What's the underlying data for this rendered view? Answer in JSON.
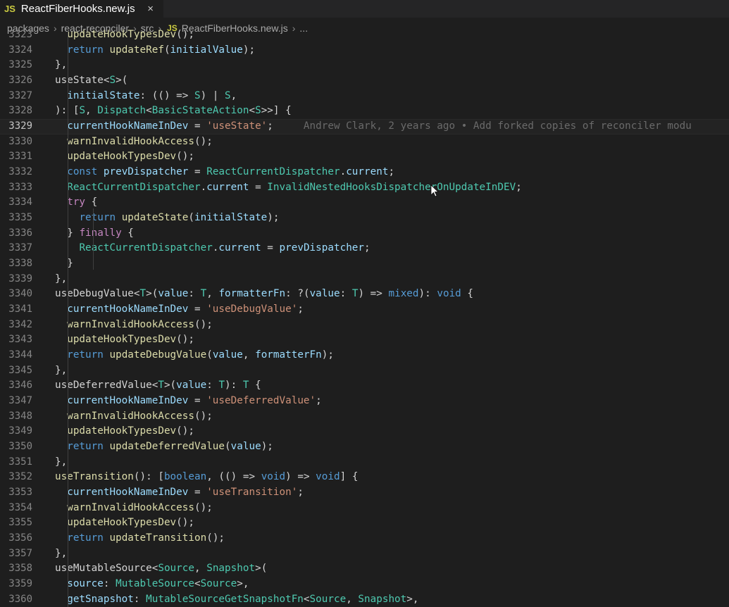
{
  "tab": {
    "icon": "JS",
    "title": "ReactFiberHooks.new.js",
    "close": "×"
  },
  "breadcrumb": [
    "packages",
    "react-reconciler",
    "src",
    "ReactFiberHooks.new.js",
    "..."
  ],
  "breadcrumb_file_icon": "JS",
  "editor": {
    "active_line": "3329",
    "blame": "Andrew Clark, 2 years ago • Add forked copies of reconciler modu",
    "lines": [
      {
        "n": "3323",
        "t": "      updateHookTypesDev();"
      },
      {
        "n": "3324",
        "t": "      return updateRef(initialValue);"
      },
      {
        "n": "3325",
        "t": "    },"
      },
      {
        "n": "3326",
        "t": "    useState<S>("
      },
      {
        "n": "3327",
        "t": "      initialState: (() => S) | S,"
      },
      {
        "n": "3328",
        "t": "    ): [S, Dispatch<BasicStateAction<S>>] {"
      },
      {
        "n": "3329",
        "t": "      currentHookNameInDev = 'useState';"
      },
      {
        "n": "3330",
        "t": "      warnInvalidHookAccess();"
      },
      {
        "n": "3331",
        "t": "      updateHookTypesDev();"
      },
      {
        "n": "3332",
        "t": "      const prevDispatcher = ReactCurrentDispatcher.current;"
      },
      {
        "n": "3333",
        "t": "      ReactCurrentDispatcher.current = InvalidNestedHooksDispatcherOnUpdateInDEV;"
      },
      {
        "n": "3334",
        "t": "      try {"
      },
      {
        "n": "3335",
        "t": "        return updateState(initialState);"
      },
      {
        "n": "3336",
        "t": "      } finally {"
      },
      {
        "n": "3337",
        "t": "        ReactCurrentDispatcher.current = prevDispatcher;"
      },
      {
        "n": "3338",
        "t": "      }"
      },
      {
        "n": "3339",
        "t": "    },"
      },
      {
        "n": "3340",
        "t": "    useDebugValue<T>(value: T, formatterFn: ?(value: T) => mixed): void {"
      },
      {
        "n": "3341",
        "t": "      currentHookNameInDev = 'useDebugValue';"
      },
      {
        "n": "3342",
        "t": "      warnInvalidHookAccess();"
      },
      {
        "n": "3343",
        "t": "      updateHookTypesDev();"
      },
      {
        "n": "3344",
        "t": "      return updateDebugValue(value, formatterFn);"
      },
      {
        "n": "3345",
        "t": "    },"
      },
      {
        "n": "3346",
        "t": "    useDeferredValue<T>(value: T): T {"
      },
      {
        "n": "3347",
        "t": "      currentHookNameInDev = 'useDeferredValue';"
      },
      {
        "n": "3348",
        "t": "      warnInvalidHookAccess();"
      },
      {
        "n": "3349",
        "t": "      updateHookTypesDev();"
      },
      {
        "n": "3350",
        "t": "      return updateDeferredValue(value);"
      },
      {
        "n": "3351",
        "t": "    },"
      },
      {
        "n": "3352",
        "t": "    useTransition(): [boolean, (() => void) => void] {"
      },
      {
        "n": "3353",
        "t": "      currentHookNameInDev = 'useTransition';"
      },
      {
        "n": "3354",
        "t": "      warnInvalidHookAccess();"
      },
      {
        "n": "3355",
        "t": "      updateHookTypesDev();"
      },
      {
        "n": "3356",
        "t": "      return updateTransition();"
      },
      {
        "n": "3357",
        "t": "    },"
      },
      {
        "n": "3358",
        "t": "    useMutableSource<Source, Snapshot>("
      },
      {
        "n": "3359",
        "t": "      source: MutableSource<Source>,"
      },
      {
        "n": "3360",
        "t": "      getSnapshot: MutableSourceGetSnapshotFn<Source, Snapshot>,"
      }
    ]
  },
  "colors": {
    "keyword": "#569cd6",
    "control": "#c586c0",
    "function": "#dcdcaa",
    "variable": "#9cdcfe",
    "type": "#4ec9b0",
    "string": "#ce9178",
    "text": "#d4d4d4"
  }
}
